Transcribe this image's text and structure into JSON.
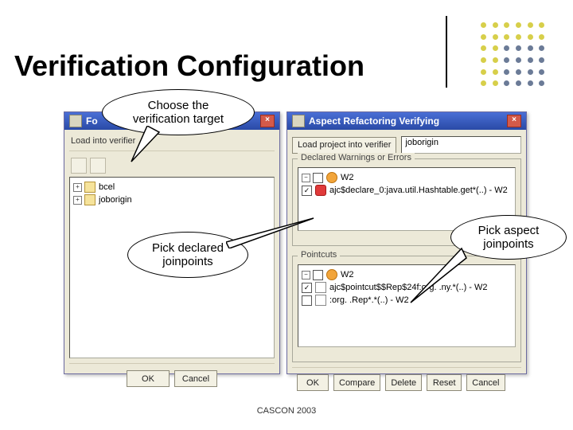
{
  "slide": {
    "title": "Verification Configuration",
    "footer": "CASCON 2003"
  },
  "callouts": {
    "target": "Choose the\nverification target",
    "declared": "Pick declared\njoinpoints",
    "aspect": "Pick aspect\njoinpoints"
  },
  "leftWindow": {
    "title": "Fo",
    "section": "Load into verifier",
    "tree": {
      "node1": "bcel",
      "node2": "joborigin"
    },
    "buttons": {
      "ok": "OK",
      "cancel": "Cancel"
    }
  },
  "rightWindow": {
    "title": "Aspect Refactoring Verifying",
    "loadLabel": "Load project into verifier",
    "loadValue": "joborigin",
    "declGroup": "Declared Warnings or Errors",
    "decl": {
      "root": "W2",
      "item": "ajc$declare_0:java.util.Hashtable.get*(..) - W2"
    },
    "pcGroup": "Pointcuts",
    "pc": {
      "root": "W2",
      "item1": "ajc$pointcut$$Rep$24f:org. .ny.*(..) - W2",
      "item2": ":org. .Rep*.*(..) - W2"
    },
    "buttons": {
      "ok": "OK",
      "compare": "Compare",
      "delete": "Delete",
      "reset": "Reset",
      "cancel": "Cancel"
    }
  }
}
